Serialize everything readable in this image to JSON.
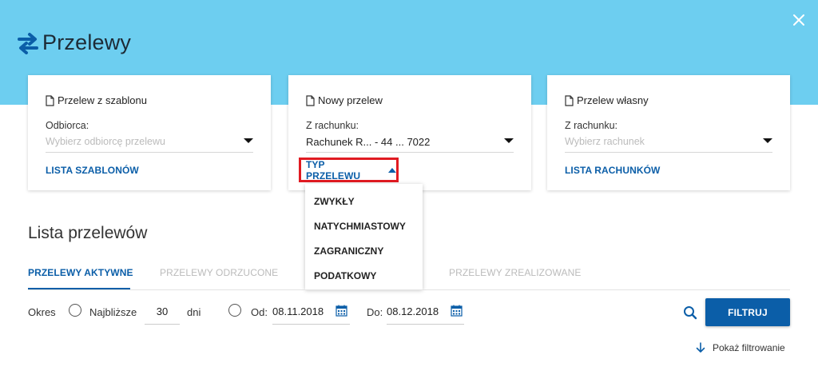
{
  "header": {
    "title": "Przelewy",
    "banner_color": "#6dcef0",
    "title_icon": "transfer-arrows-icon",
    "close_icon": "close-icon"
  },
  "cards": {
    "template": {
      "title": "Przelew z szablonu",
      "field_label": "Odbiorca:",
      "placeholder": "Wybierz odbiorcę przelewu",
      "link": "LISTA SZABLONÓW"
    },
    "new_transfer": {
      "title": "Nowy przelew",
      "field_label": "Z rachunku:",
      "value": "Rachunek R...  - 44 ... 7022",
      "type_toggle": "TYP PRZELEWU",
      "type_options": [
        "ZWYKŁY",
        "NATYCHMIASTOWY",
        "ZAGRANICZNY",
        "PODATKOWY"
      ]
    },
    "own_transfer": {
      "title": "Przelew własny",
      "field_label": "Z rachunku:",
      "placeholder": "Wybierz rachunek",
      "link": "LISTA RACHUNKÓW"
    }
  },
  "list": {
    "title": "Lista przelewów",
    "tabs": [
      {
        "label": "PRZELEWY AKTYWNE",
        "active": true
      },
      {
        "label": "PRZELEWY ODRZUCONE",
        "active": false
      },
      {
        "label": "PRZELEWY ZREALIZOWANE",
        "active": false
      }
    ]
  },
  "filter": {
    "period_label": "Okres",
    "nearest_label": "Najbliższe",
    "days_value": "30",
    "days_label": "dni",
    "from_label": "Od:",
    "from_date": "08.11.2018",
    "to_label": "Do:",
    "to_date": "08.12.2018",
    "filter_button": "FILTRUJ",
    "show_filtering": "Pokaż filtrowanie"
  },
  "colors": {
    "accent": "#0b5ea8",
    "highlight_border": "#e01b22"
  }
}
